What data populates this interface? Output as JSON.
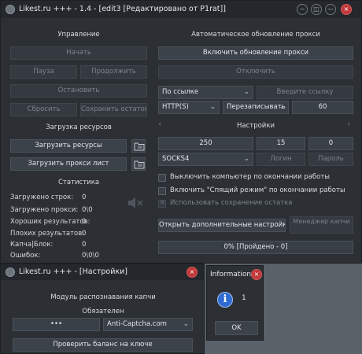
{
  "main": {
    "title": "Likest.ru +++ - 1.4 - [edit3 [Редактировано от P1rat]]",
    "controls": [
      "−",
      "◫",
      "—",
      "×"
    ],
    "management": {
      "title": "Управление",
      "start": "Начать",
      "pause": "Пауза",
      "resume": "Продолжить",
      "stop": "Остановить",
      "reset": "Сбросить",
      "save_rest": "Сохранить остаток"
    },
    "resources": {
      "title": "Загрузка ресурсов",
      "load_resources": "Загрузить ресурсы",
      "load_proxy": "Загрузить прокси лист"
    },
    "stats": {
      "title": "Статистика",
      "rows": [
        {
          "label": "Загружено строк:",
          "value": "0"
        },
        {
          "label": "Загружено прокси:",
          "value": "0\\0"
        },
        {
          "label": "Хороших результатов:",
          "value": "0"
        },
        {
          "label": "Плохих результатов:",
          "value": "0"
        },
        {
          "label": "Капча|Блок:",
          "value": "0"
        },
        {
          "label": "Ошибок:",
          "value": "0\\0\\0"
        }
      ]
    },
    "proxy_update": {
      "title": "Автоматическое обновление прокси",
      "enable": "Включить обновление прокси",
      "disable": "Отключить",
      "by_link": "По ссылке",
      "link_placeholder": "Введите ссылку",
      "protocol": "HTTP(S)",
      "mode": "Перезаписывать",
      "interval": "60"
    },
    "settings": {
      "title": "Настройки",
      "threads": "250",
      "timeout": "15",
      "retries": "0",
      "socks": "SOCKS4",
      "login": "Логин",
      "password": "Пароль",
      "opt_shutdown": "Выключить компьютер по окончании работы",
      "opt_sleep": "Включить \"Спящий режим\" по окончании работы",
      "opt_save_rest": "Использовать сохранение остатка",
      "open_more": "Открыть дополнительные настройки",
      "captcha_manager": "Менеджер капчи",
      "progress": "0% [Пройдено - 0]"
    }
  },
  "settings_window": {
    "title": "Likest.ru +++ - [Настройки]",
    "module_title": "Модуль распознавания капчи",
    "required": "Обязателен",
    "key": "•••",
    "service": "Anti-Captcha.com",
    "check_balance": "Проверить баланс на ключе"
  },
  "info_window": {
    "title": "Information",
    "message": "1",
    "ok": "OK"
  },
  "colors": {
    "background": "#2c3035",
    "button": "#3c4249",
    "close": "#c0393a",
    "info": "#2f6bd1"
  }
}
